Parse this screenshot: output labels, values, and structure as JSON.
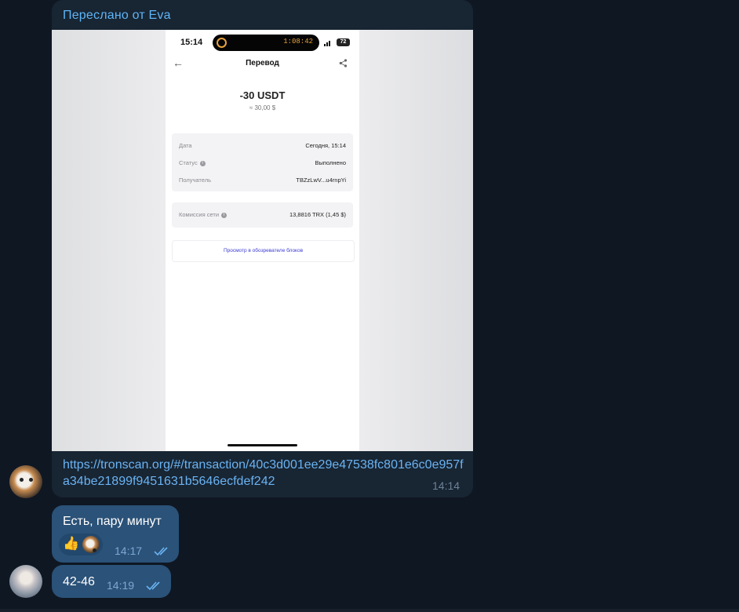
{
  "forwarded": {
    "title": "Переслано от Eva",
    "link": "https://tronscan.org/#/transaction/40c3d001ee29e47538fc801e6c0e957fa34be21899f9451631b5646ecfdef242",
    "time": "14:14"
  },
  "screenshot": {
    "clock": "15:14",
    "timer": "1:08:42",
    "battery": "72",
    "header_title": "Перевод",
    "amount": "-30 USDT",
    "amount_fiat": "≈ 30,00 $",
    "rows": [
      {
        "label": "Дата",
        "value": "Сегодня, 15:14"
      },
      {
        "label": "Статус",
        "value": "Выполнено"
      },
      {
        "label": "Получатель",
        "value": "TBZzLwV...u4rnpYi"
      }
    ],
    "fee_label": "Комиссия сети",
    "fee_value": "13,8816 TRX (1,45 $)",
    "explorer_button": "Просмотр в обозревателе блоков"
  },
  "messages": [
    {
      "text": "Есть, пару минут",
      "time": "14:17",
      "reaction": "👍"
    },
    {
      "text": "42-46",
      "time": "14:19"
    }
  ],
  "colors": {
    "bg": "#0f1723",
    "incoming": "#182533",
    "outgoing": "#2b5278",
    "link": "#6ab3f3"
  }
}
